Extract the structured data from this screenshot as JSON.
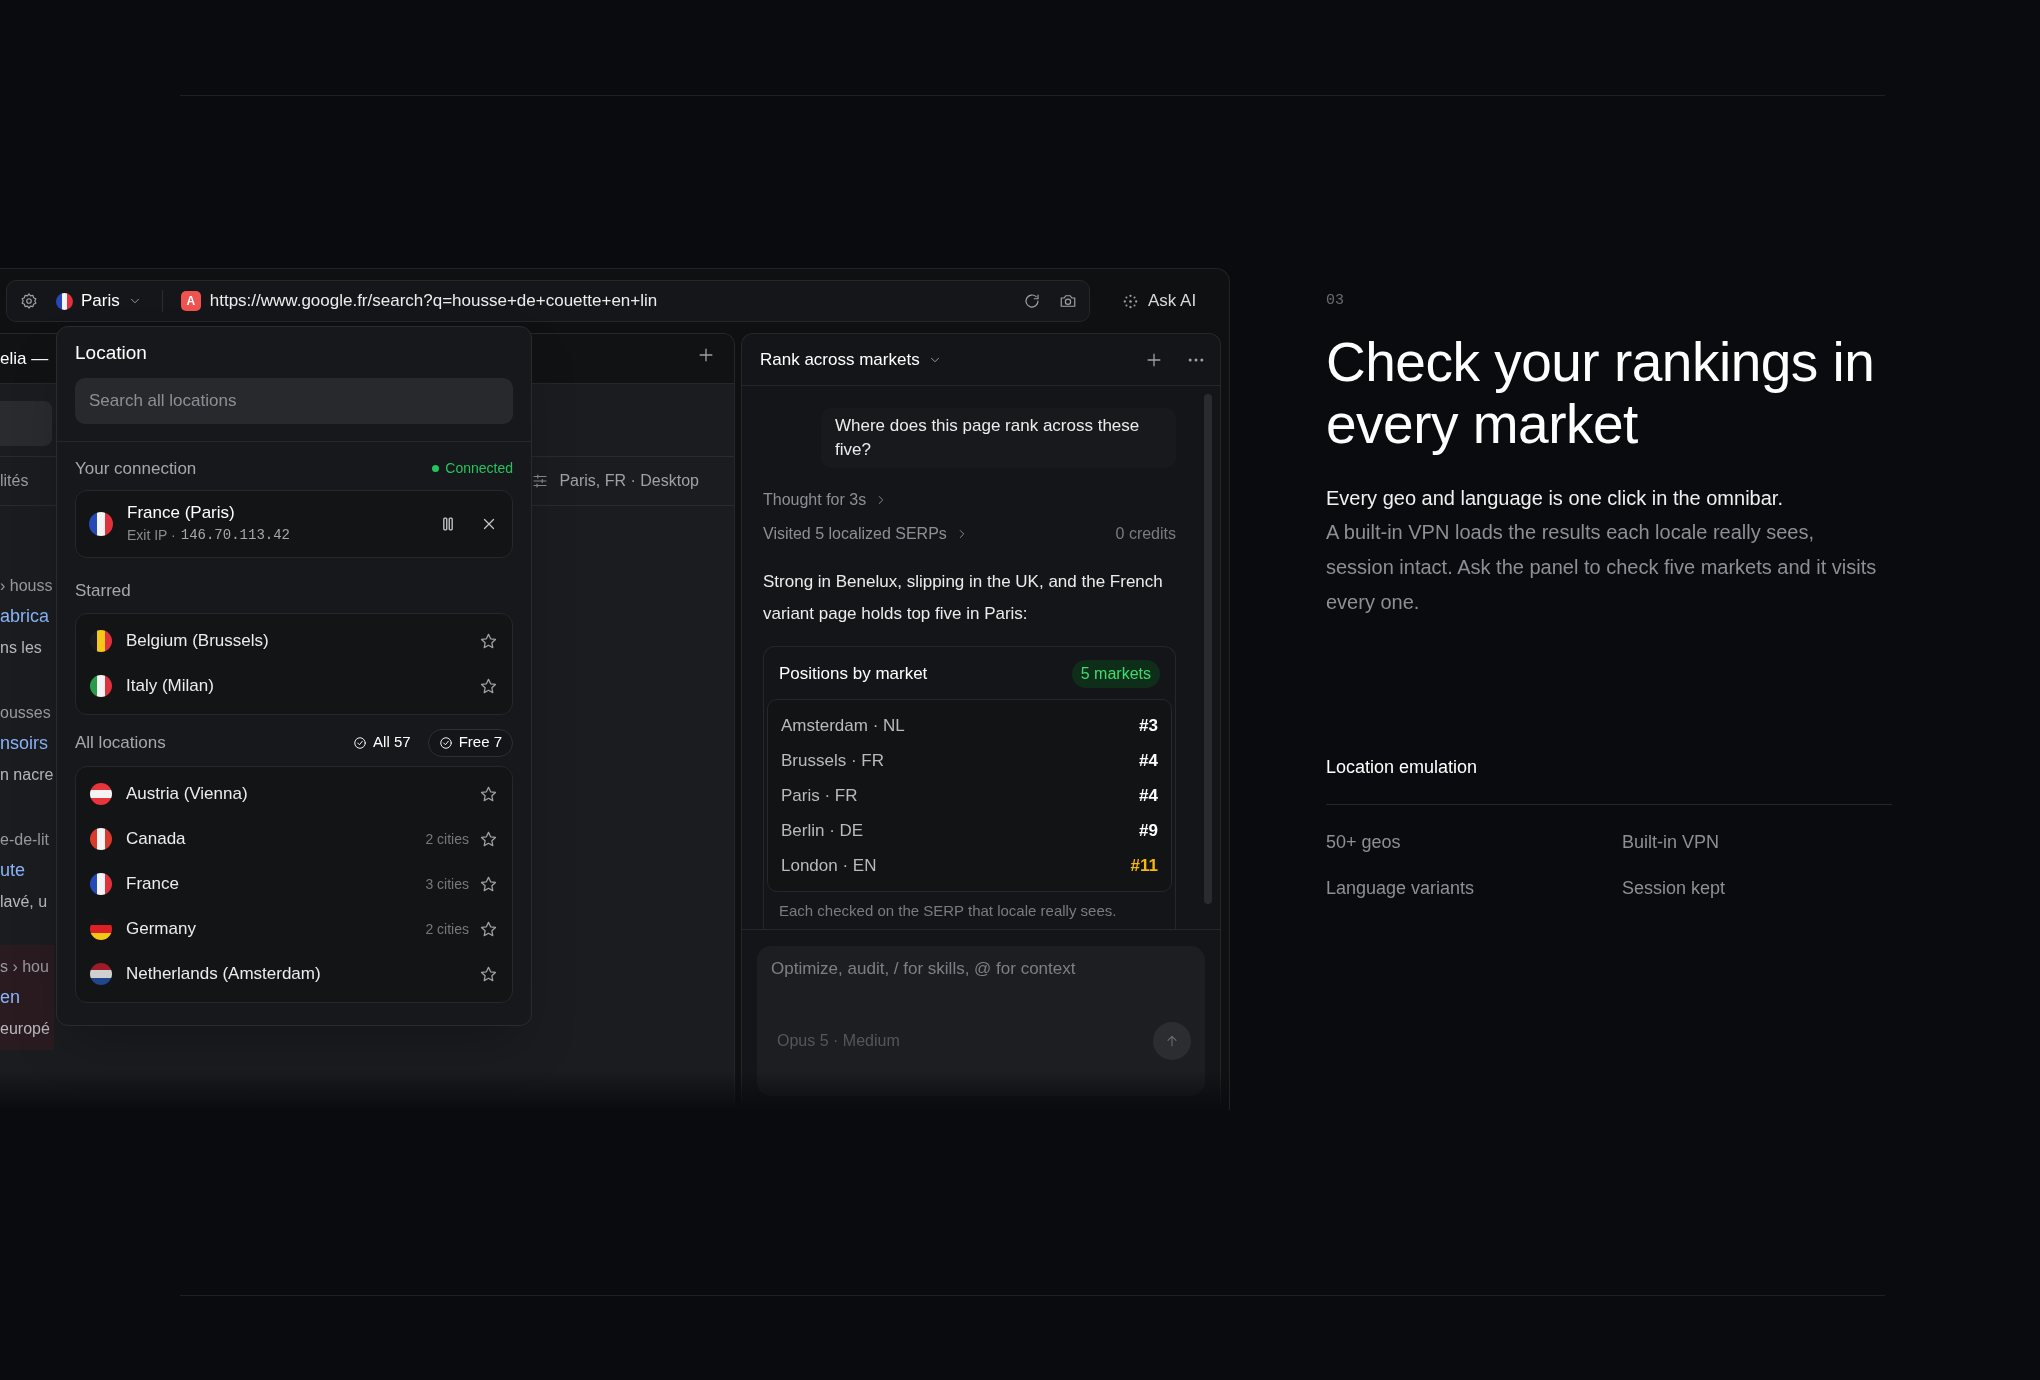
{
  "browser": {
    "location_button": {
      "label": "Paris",
      "kind": "france"
    },
    "site_badge": "A",
    "url": "https://www.google.fr/search?q=housse+de+couette+en+lin",
    "ask_ai": "Ask AI"
  },
  "page_pane": {
    "tab_title": "elia —",
    "filter_label": "lités",
    "device": "Paris, FR · Desktop",
    "results": [
      {
        "breadcrumb": "› houss",
        "title": "abrica",
        "snippet": "ns les",
        "selected": false
      },
      {
        "breadcrumb": "ousses",
        "title": "nsoirs",
        "snippet": "n nacre",
        "selected": false
      },
      {
        "breadcrumb": "e-de-lit",
        "title": "ute",
        "snippet": "lavé, u",
        "selected": false
      },
      {
        "breadcrumb": "s › hou",
        "title": "en",
        "snippet": "europé",
        "selected": true
      }
    ]
  },
  "location_popover": {
    "title": "Location",
    "search": {
      "placeholder": "Search all locations"
    },
    "connection": {
      "label": "Your connection",
      "status": "Connected",
      "connected": true,
      "name": "France (Paris)",
      "exit_label": "Exit IP ·",
      "exit_ip": "146.70.113.42",
      "kind": "france"
    },
    "starred_label": "Starred",
    "starred": [
      {
        "name": "Belgium (Brussels)",
        "kind": "belgium"
      },
      {
        "name": "Italy (Milan)",
        "kind": "italy"
      }
    ],
    "all_label": "All locations",
    "filters": [
      {
        "label": "All 57",
        "selected": false
      },
      {
        "label": "Free 7",
        "selected": true
      }
    ],
    "locations": [
      {
        "name": "Austria (Vienna)",
        "kind": "austria"
      },
      {
        "name": "Canada",
        "cities": "2 cities",
        "kind": "canada"
      },
      {
        "name": "France",
        "cities": "3 cities",
        "kind": "france"
      },
      {
        "name": "Germany",
        "cities": "2 cities",
        "kind": "germany"
      },
      {
        "name": "Netherlands (Amsterdam)",
        "kind": "netherlands"
      }
    ]
  },
  "chat": {
    "title": "Rank across markets",
    "user_message": "Where does this page rank across these five?",
    "steps": [
      {
        "label": "Thought for 3s"
      },
      {
        "label": "Visited 5 localized SERPs",
        "meta": "0 credits"
      }
    ],
    "answer": "Strong in Benelux, slipping in the UK, and the French variant page holds top five in Paris:",
    "card": {
      "title": "Positions by market",
      "badge": "5 markets",
      "rows": [
        {
          "market": "Amsterdam · NL",
          "position": "#3",
          "color": "#ffffff"
        },
        {
          "market": "Brussels · FR",
          "position": "#4",
          "color": "#ffffff"
        },
        {
          "market": "Paris · FR",
          "position": "#4",
          "color": "#ffffff"
        },
        {
          "market": "Berlin · DE",
          "position": "#9",
          "color": "#ffffff"
        },
        {
          "market": "London · EN",
          "position": "#11",
          "color": "#f5b70f"
        }
      ],
      "footnote": "Each checked on the SERP that locale really sees."
    },
    "composer": {
      "placeholder": "Optimize, audit, / for skills, @ for context",
      "model": "Opus 5 · Medium"
    }
  },
  "section": {
    "number": "03",
    "heading": "Check your rankings in every market",
    "lead": "Every geo and language is one click in the omnibar.",
    "body": "A built-in VPN loads the results each locale really sees, session intact. Ask the panel to check five markets and it visits every one.",
    "features_title": "Location emulation",
    "features": [
      "50+ geos",
      "Built-in VPN",
      "Language variants",
      "Session kept"
    ]
  }
}
